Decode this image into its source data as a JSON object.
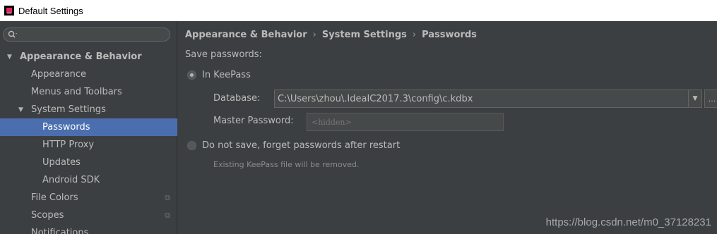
{
  "window": {
    "title": "Default Settings"
  },
  "search": {
    "placeholder": ""
  },
  "sidebar": {
    "items": [
      {
        "label": "Appearance & Behavior"
      },
      {
        "label": "Appearance"
      },
      {
        "label": "Menus and Toolbars"
      },
      {
        "label": "System Settings"
      },
      {
        "label": "Passwords"
      },
      {
        "label": "HTTP Proxy"
      },
      {
        "label": "Updates"
      },
      {
        "label": "Android SDK"
      },
      {
        "label": "File Colors"
      },
      {
        "label": "Scopes"
      },
      {
        "label": "Notifications"
      }
    ]
  },
  "breadcrumb": [
    "Appearance & Behavior",
    "System Settings",
    "Passwords"
  ],
  "form": {
    "save_label": "Save passwords:",
    "keepass_label": "In KeePass",
    "database_label": "Database:",
    "database_value": "C:\\Users\\zhou\\.IdeaIC2017.3\\config\\c.kdbx",
    "browse_label": "...",
    "master_label": "Master Password:",
    "master_placeholder": "<hidden>",
    "nosave_label": "Do not save, forget passwords after restart",
    "hint": "Existing KeePass file will be removed."
  },
  "watermark": "https://blog.csdn.net/m0_37128231",
  "colors": {
    "selection": "#4b6eaf",
    "background": "#3c3f41"
  }
}
